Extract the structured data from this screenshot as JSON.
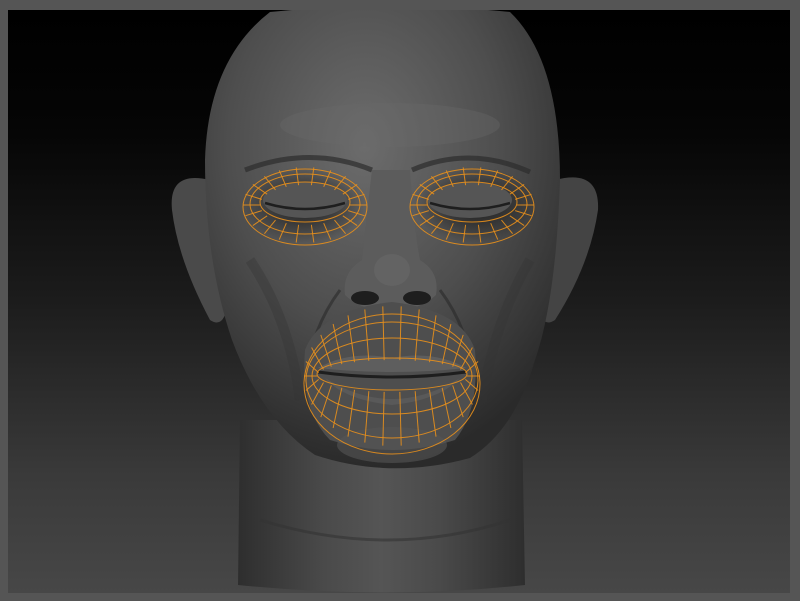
{
  "viewport": {
    "background_top": "#000000",
    "background_bottom": "#474747",
    "frame_color": "#555555"
  },
  "model": {
    "subject": "sculpted-head",
    "skin_color": "#5a5a5a",
    "wireframe_color": "#e8901c",
    "wireframe_regions": [
      "left-eye",
      "right-eye",
      "mouth"
    ]
  }
}
